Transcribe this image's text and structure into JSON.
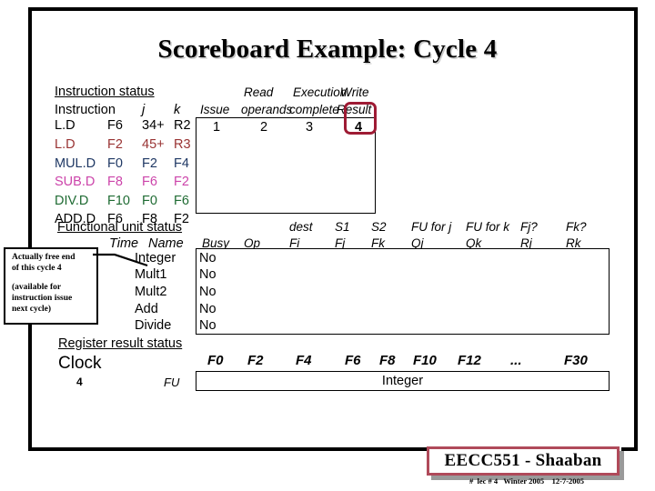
{
  "title": "Scoreboard Example:  Cycle 4",
  "instruction_status": {
    "heading": "Instruction status",
    "col_headers": {
      "instruction": "Instruction",
      "j": "j",
      "k": "k",
      "issue": "Issue",
      "read_operands_top": "Read",
      "read_operands_bottom": "operands",
      "execution_complete_top": "Execution",
      "execution_complete_bottom": "complete",
      "write_result_top": "Write",
      "write_result_bottom": "Result"
    },
    "rows": [
      {
        "op": "L.D",
        "dest": "F6",
        "j": "34+",
        "k": "R2",
        "color": "#000000"
      },
      {
        "op": "L.D",
        "dest": "F2",
        "j": "45+",
        "k": "R3",
        "color": "#993333"
      },
      {
        "op": "MUL.D",
        "dest": "F0",
        "j": "F2",
        "k": "F4",
        "color": "#1f3864"
      },
      {
        "op": "SUB.D",
        "dest": "F8",
        "j": "F6",
        "k": "F2",
        "color": "#cc44aa"
      },
      {
        "op": "DIV.D",
        "dest": "F10",
        "j": "F0",
        "k": "F6",
        "color": "#1f6b33"
      },
      {
        "op": "ADD.D",
        "dest": "F6",
        "j": "F8",
        "k": "F2",
        "color": "#000000"
      }
    ],
    "cycle_values": {
      "issue": "1",
      "read_operands": "2",
      "execution_complete": "3",
      "write_result": "4"
    },
    "highlight_color": "#9e1b34"
  },
  "functional_unit_status": {
    "heading": "Functional unit status",
    "time_label": "Time",
    "name_label": "Name",
    "col_headers_top": [
      "",
      "",
      "dest",
      "S1",
      "S2",
      "FU for j",
      "FU for k",
      "Fj?",
      "Fk?"
    ],
    "col_headers_bottom": [
      "Busy",
      "Op",
      "Fi",
      "Fj",
      "Fk",
      "Qj",
      "Qk",
      "Rj",
      "Rk"
    ],
    "rows": [
      {
        "name": "Integer",
        "time": "",
        "busy": "No",
        "op": "",
        "fi": "",
        "fj": "",
        "fk": "",
        "qj": "",
        "qk": "",
        "rj": "",
        "rk": ""
      },
      {
        "name": "Mult1",
        "time": "",
        "busy": "No",
        "op": "",
        "fi": "",
        "fj": "",
        "fk": "",
        "qj": "",
        "qk": "",
        "rj": "",
        "rk": ""
      },
      {
        "name": "Mult2",
        "time": "",
        "busy": "No",
        "op": "",
        "fi": "",
        "fj": "",
        "fk": "",
        "qj": "",
        "qk": "",
        "rj": "",
        "rk": ""
      },
      {
        "name": "Add",
        "time": "",
        "busy": "No",
        "op": "",
        "fi": "",
        "fj": "",
        "fk": "",
        "qj": "",
        "qk": "",
        "rj": "",
        "rk": ""
      },
      {
        "name": "Divide",
        "time": "",
        "busy": "No",
        "op": "",
        "fi": "",
        "fj": "",
        "fk": "",
        "qj": "",
        "qk": "",
        "rj": "",
        "rk": ""
      }
    ]
  },
  "register_result_status": {
    "heading": "Register result status",
    "clock_label": "Clock",
    "clock_value": "4",
    "fu_label": "FU",
    "registers": [
      "F0",
      "F2",
      "F4",
      "F6",
      "F8",
      "F10",
      "F12",
      "...",
      "F30"
    ],
    "entry": "Integer"
  },
  "callout": {
    "line1": "Actually free end",
    "line2": "of this cycle 4",
    "line3": "(available for",
    "line4": "instruction issue",
    "line5": "next cycle)"
  },
  "footer": {
    "badge": "EECC551 - Shaaban",
    "note": "#  lec # 4   Winter 2005    12-7-2005",
    "badge_border_color": "#b04a5a"
  }
}
